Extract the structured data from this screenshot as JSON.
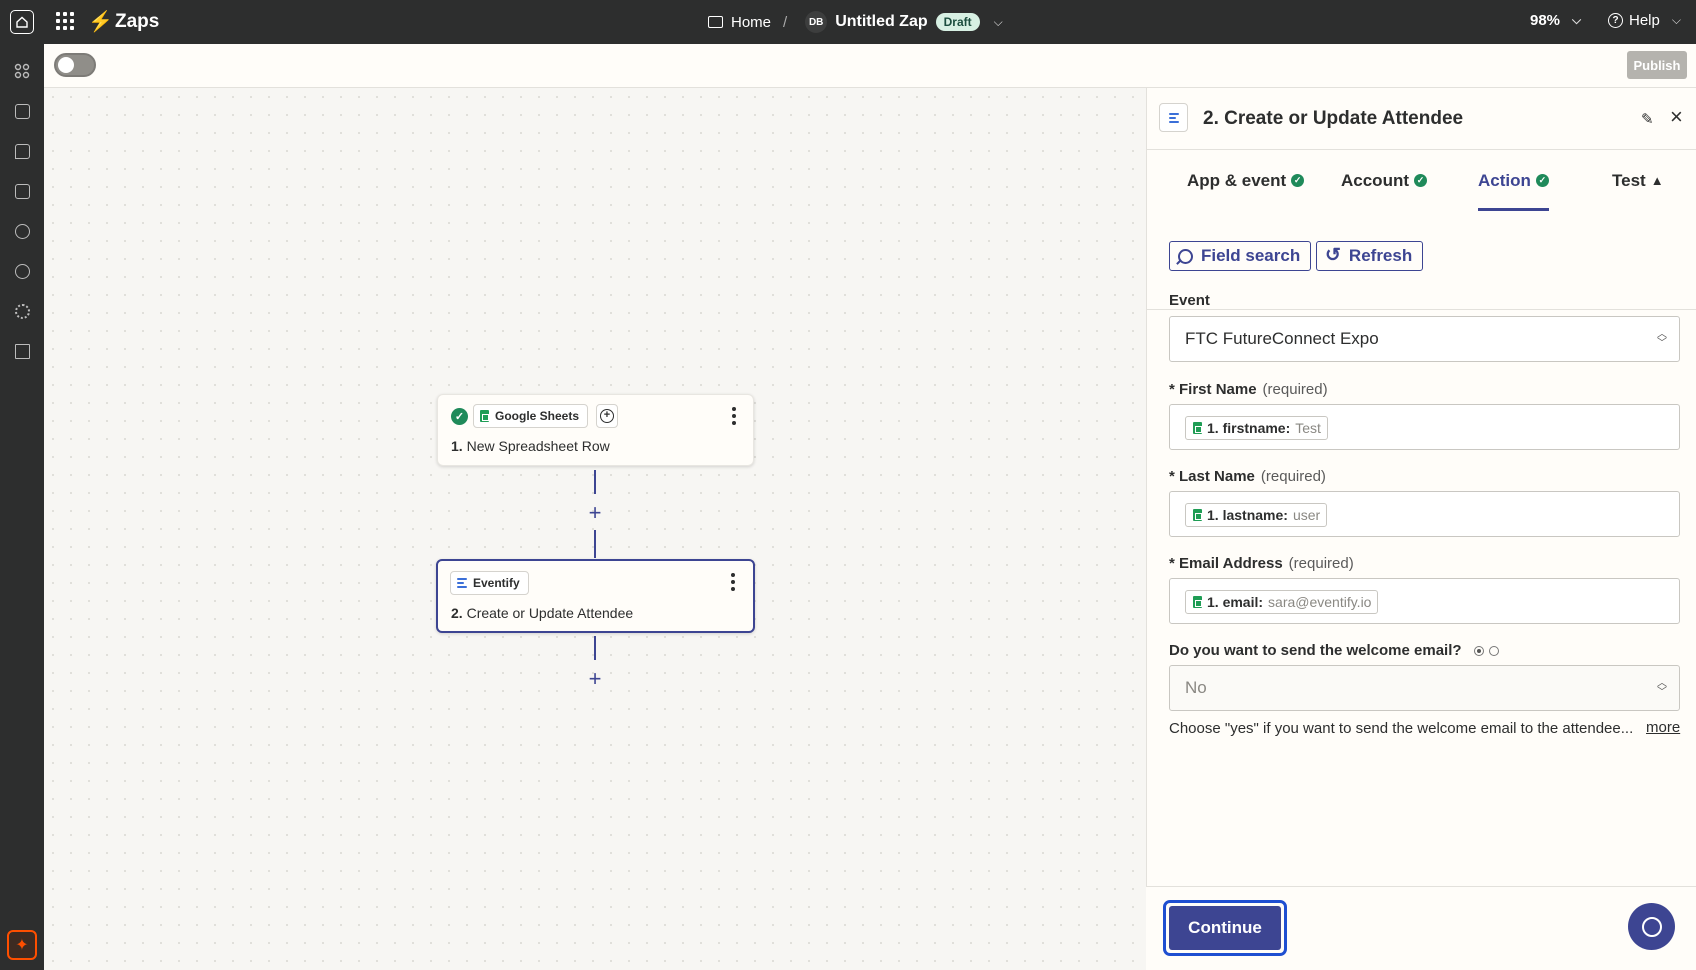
{
  "topbar": {
    "app_title": "Zaps",
    "breadcrumb_home": "Home",
    "breadcrumb_sep": "/",
    "avatar_initials": "DB",
    "zap_name": "Untitled Zap",
    "status_badge": "Draft",
    "zoom_level": "98%",
    "help_label": "Help"
  },
  "toolbar": {
    "publish_label": "Publish",
    "zap_enabled": false
  },
  "canvas": {
    "step1": {
      "app_name": "Google Sheets",
      "number": "1.",
      "title": "New Spreadsheet Row"
    },
    "step2": {
      "app_name": "Eventify",
      "number": "2.",
      "title": "Create or Update Attendee"
    }
  },
  "panel": {
    "title": "2. Create or Update Attendee",
    "tabs": [
      {
        "label": "App & event",
        "status": "complete"
      },
      {
        "label": "Account",
        "status": "complete"
      },
      {
        "label": "Action",
        "status": "complete"
      },
      {
        "label": "Test",
        "status": "warning"
      }
    ],
    "field_search_label": "Field search",
    "refresh_label": "Refresh",
    "event": {
      "label": "Event",
      "value": "FTC FutureConnect Expo"
    },
    "first_name": {
      "label": "First Name",
      "required_note": "(required)",
      "pill_key": "1. firstname:",
      "pill_value": "Test"
    },
    "last_name": {
      "label": "Last Name",
      "required_note": "(required)",
      "pill_key": "1. lastname:",
      "pill_value": "user"
    },
    "email": {
      "label": "Email Address",
      "required_note": "(required)",
      "pill_key": "1. email:",
      "pill_value": "sara@eventify.io"
    },
    "welcome_email": {
      "label": "Do you want to send the welcome email?",
      "value": "No",
      "help_text": "Choose \"yes\" if you want to send the welcome email to the attendee...",
      "more_label": "more"
    },
    "continue_label": "Continue"
  },
  "colors": {
    "topbar_bg": "#2d2e2e",
    "accent": "#3d4592",
    "brand_orange": "#ff4f00",
    "success_green": "#1f8a5a"
  }
}
